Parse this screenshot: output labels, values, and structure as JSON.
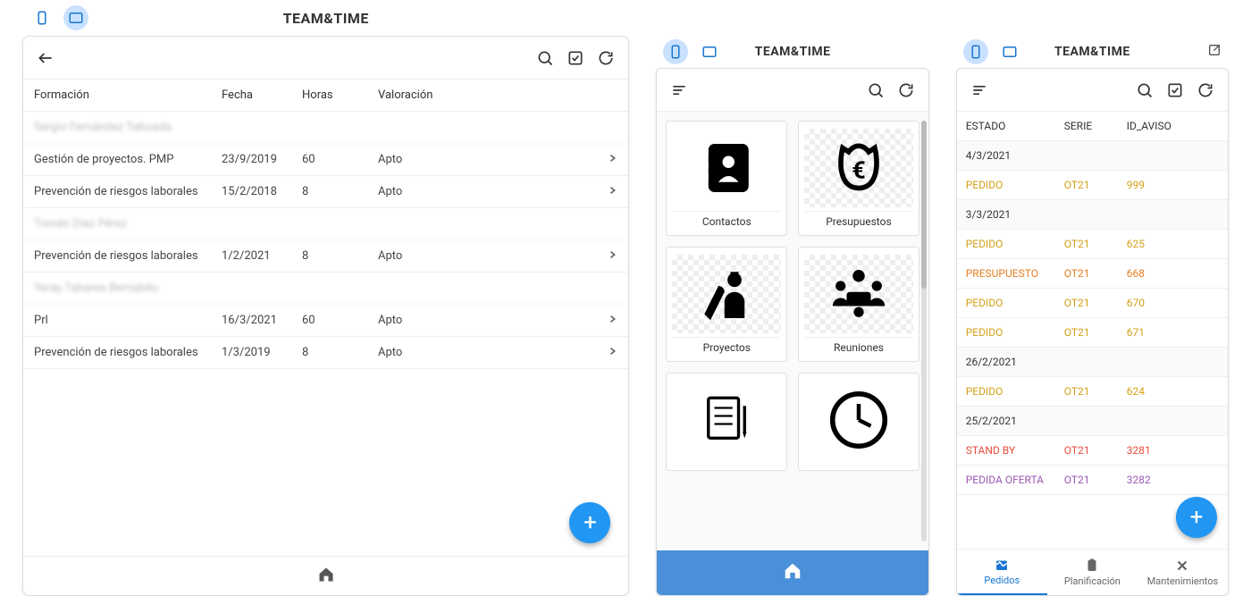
{
  "app_title": "TEAM&TIME",
  "panel1": {
    "columns": {
      "c1": "Formación",
      "c2": "Fecha",
      "c3": "Horas",
      "c4": "Valoración"
    },
    "groups": [
      {
        "header": "Sergio Fernández Taboada",
        "rows": [
          {
            "name": "Gestión de proyectos. PMP",
            "date": "23/9/2019",
            "hours": "60",
            "val": "Apto"
          },
          {
            "name": "Prevención de riesgos laborales",
            "date": "15/2/2018",
            "hours": "8",
            "val": "Apto"
          }
        ]
      },
      {
        "header": "Tomás Díaz Pérez",
        "rows": [
          {
            "name": "Prevención de riesgos laborales",
            "date": "1/2/2021",
            "hours": "8",
            "val": "Apto"
          }
        ]
      },
      {
        "header": "Yeray Tabares Bernabéu",
        "rows": [
          {
            "name": "Prl",
            "date": "16/3/2021",
            "hours": "60",
            "val": "Apto"
          },
          {
            "name": "Prevención de riesgos laborales",
            "date": "1/3/2019",
            "hours": "8",
            "val": "Apto"
          }
        ]
      }
    ]
  },
  "panel2": {
    "cards": {
      "contactos": "Contactos",
      "presupuestos": "Presupuestos",
      "proyectos": "Proyectos",
      "reuniones": "Reuniones"
    }
  },
  "panel3": {
    "columns": {
      "c1": "ESTADO",
      "c2": "SERIE",
      "c3": "ID_AVISO"
    },
    "groups": [
      {
        "date": "4/3/2021",
        "rows": [
          {
            "estado": "PEDIDO",
            "serie": "OT21",
            "id": "999",
            "cls": "c-yellow"
          }
        ]
      },
      {
        "date": "3/3/2021",
        "rows": [
          {
            "estado": "PEDIDO",
            "serie": "OT21",
            "id": "625",
            "cls": "c-yellow"
          },
          {
            "estado": "PRESUPUESTO",
            "serie": "OT21",
            "id": "668",
            "cls": "c-orange"
          },
          {
            "estado": "PEDIDO",
            "serie": "OT21",
            "id": "670",
            "cls": "c-yellow"
          },
          {
            "estado": "PEDIDO",
            "serie": "OT21",
            "id": "671",
            "cls": "c-yellow"
          }
        ]
      },
      {
        "date": "26/2/2021",
        "rows": [
          {
            "estado": "PEDIDO",
            "serie": "OT21",
            "id": "624",
            "cls": "c-yellow"
          }
        ]
      },
      {
        "date": "25/2/2021",
        "rows": [
          {
            "estado": "STAND BY",
            "serie": "OT21",
            "id": "3281",
            "cls": "c-red"
          },
          {
            "estado": "PEDIDA OFERTA",
            "serie": "OT21",
            "id": "3282",
            "cls": "c-purple"
          }
        ]
      }
    ],
    "tabs": {
      "pedidos": "Pedidos",
      "planificacion": "Planificación",
      "mantenimientos": "Mantenimientos"
    }
  }
}
